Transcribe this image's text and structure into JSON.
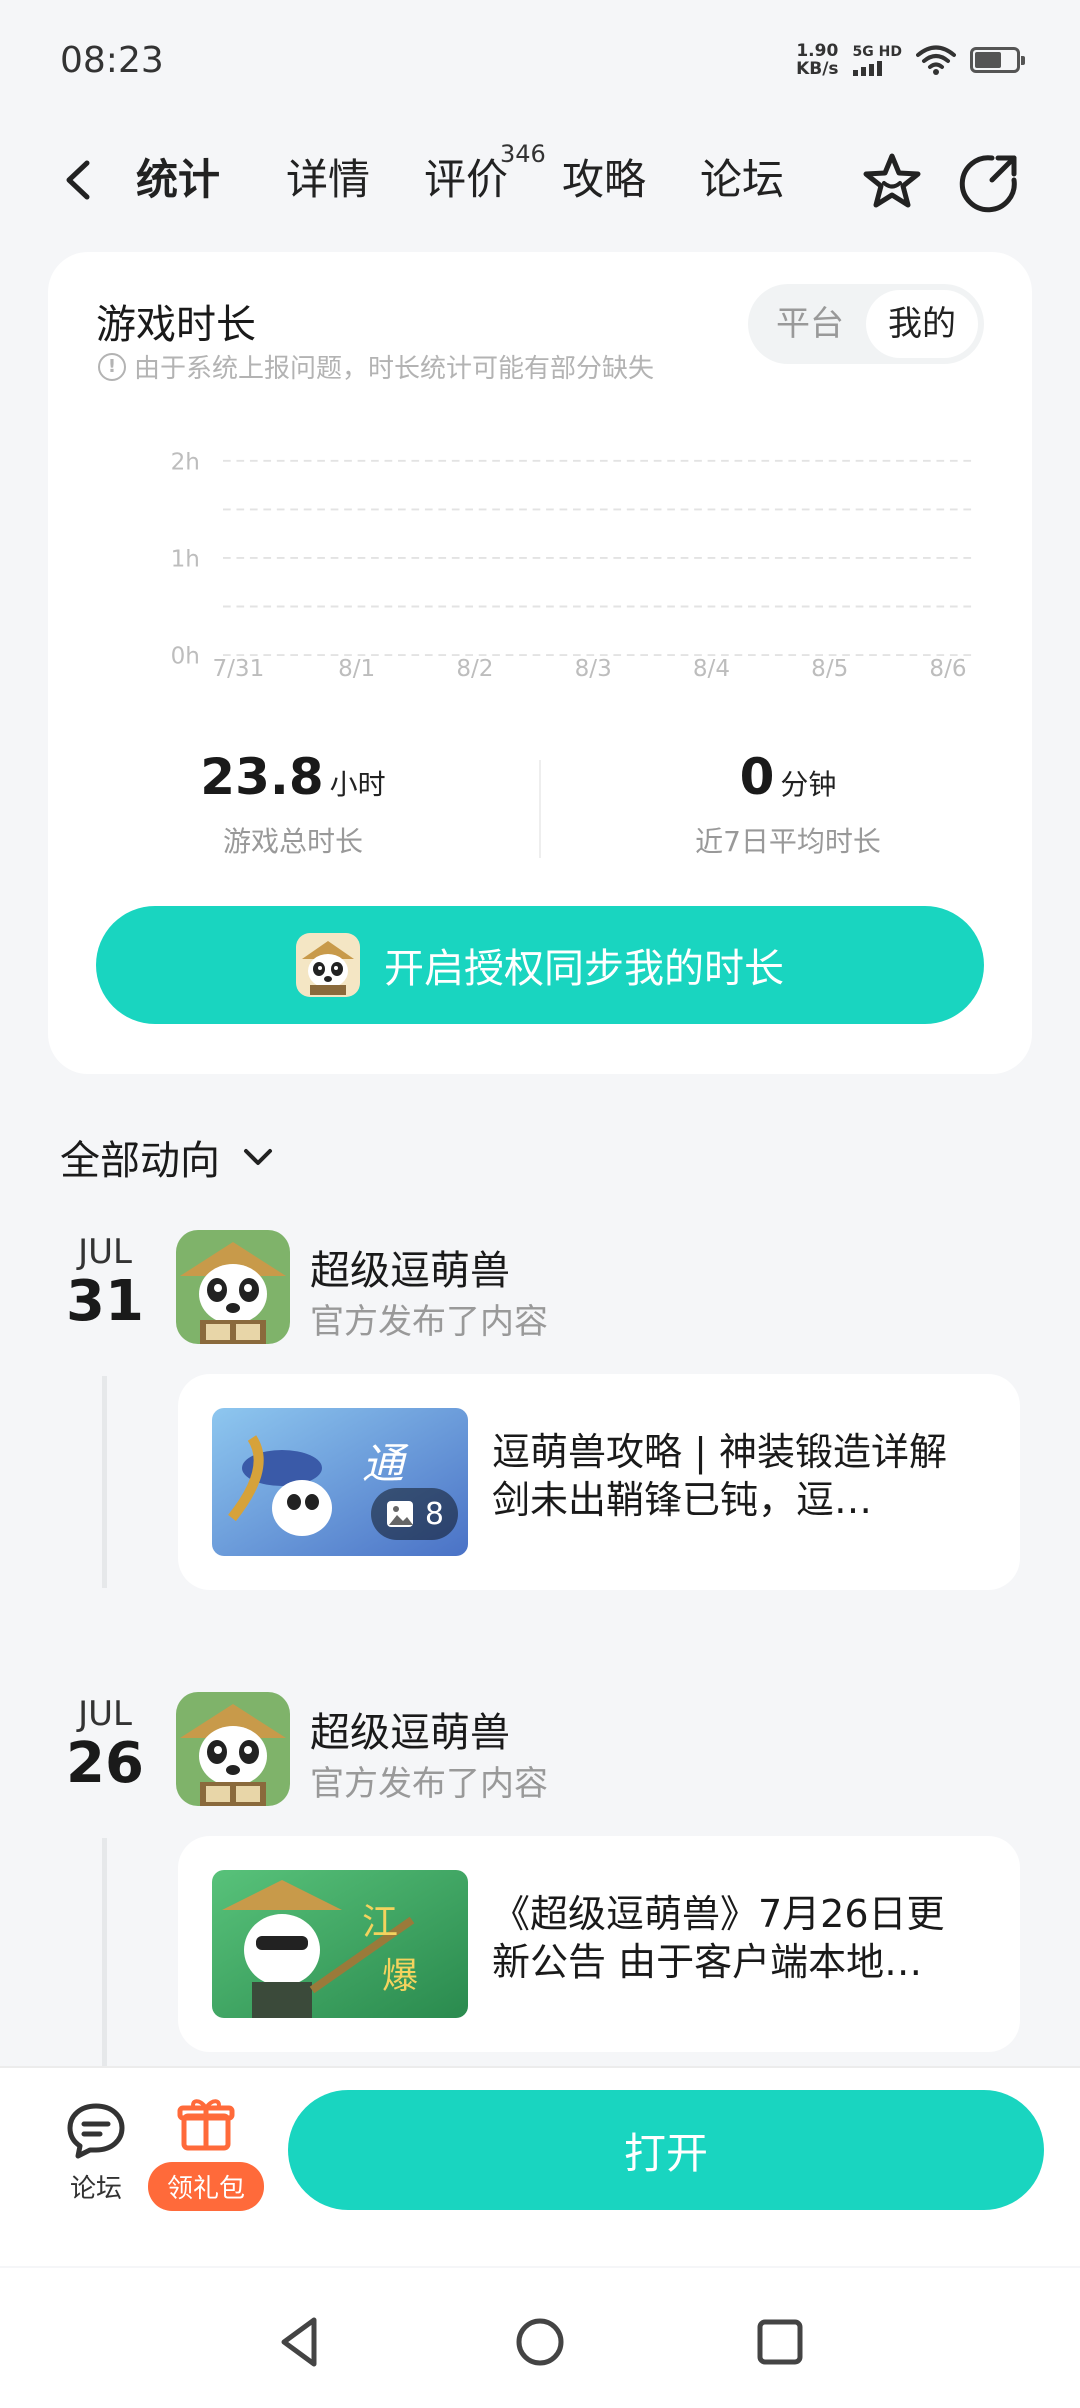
{
  "status_bar": {
    "time": "08:23",
    "net_speed_value": "1.90",
    "net_speed_unit": "KB/s",
    "network_label": "5G HD"
  },
  "nav": {
    "tabs": [
      {
        "label": "统计",
        "active": true
      },
      {
        "label": "详情",
        "active": false
      },
      {
        "label": "评价",
        "active": false,
        "badge": "346"
      },
      {
        "label": "攻略",
        "active": false
      },
      {
        "label": "论坛",
        "active": false
      }
    ],
    "icons": [
      "back-icon",
      "star-icon",
      "share-icon"
    ]
  },
  "stats": {
    "title": "游戏时长",
    "note": "由于系统上报问题，时长统计可能有部分缺失",
    "toggle": [
      "平台",
      "我的"
    ],
    "toggle_selected": "我的",
    "total_value": "23.8",
    "total_unit": "小时",
    "total_label": "游戏总时长",
    "avg_value": "0",
    "avg_unit": "分钟",
    "avg_label": "近7日平均时长",
    "sync_button": "开启授权同步我的时长"
  },
  "chart_data": {
    "type": "bar",
    "categories": [
      "7/31",
      "8/1",
      "8/2",
      "8/3",
      "8/4",
      "8/5",
      "8/6"
    ],
    "values": [
      0,
      0,
      0,
      0,
      0,
      0,
      0
    ],
    "y_ticks": [
      "0h",
      "1h",
      "2h"
    ],
    "ylim": [
      0,
      2
    ],
    "grid": true
  },
  "feed": {
    "header": "全部动向",
    "items": [
      {
        "month": "JUL",
        "day": "31",
        "name": "超级逗萌兽",
        "sub": "官方发布了内容",
        "post_text": "逗萌兽攻略 | 神装锻造详解 剑未出鞘锋已钝，逗…",
        "image_count": "8"
      },
      {
        "month": "JUL",
        "day": "26",
        "name": "超级逗萌兽",
        "sub": "官方发布了内容",
        "post_text": "《超级逗萌兽》7月26日更新公告 由于客户端本地…"
      }
    ]
  },
  "bottom_bar": {
    "forum_label": "论坛",
    "gift_label": "领礼包",
    "open_button": "打开"
  },
  "colors": {
    "accent": "#19d5c0",
    "gift": "#ff6a3a",
    "background": "#f5f6f8"
  }
}
